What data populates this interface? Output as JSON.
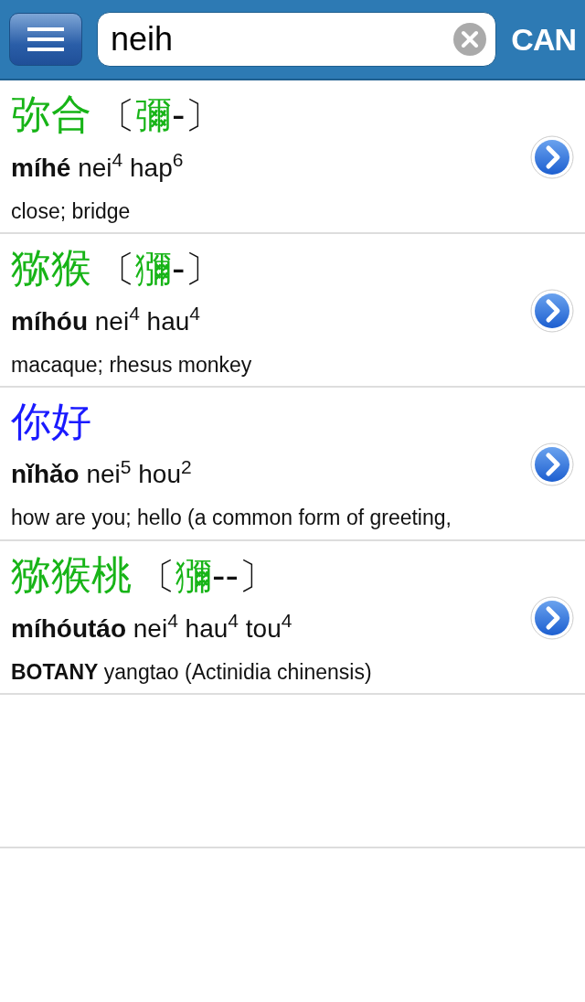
{
  "header": {
    "search": {
      "value": "neih"
    },
    "language": "CAN"
  },
  "entries": [
    {
      "headword": "弥合",
      "color": "#17b417",
      "variant": {
        "open": "〔",
        "chars": "彌",
        "fill": "-",
        "close": "〕"
      },
      "pinyin": "míhé",
      "jyutping": "nei$^{4}$ hap$^{6}$",
      "definition": "close; bridge"
    },
    {
      "headword": "猕猴",
      "color": "#17b417",
      "variant": {
        "open": "〔",
        "chars": "獼",
        "fill": "-",
        "close": "〕"
      },
      "pinyin": "míhóu",
      "jyutping": "nei$^{4}$ hau$^{4}$",
      "definition": "macaque; rhesus monkey"
    },
    {
      "headword": "你好",
      "color": "#1a1aff",
      "pinyin": "nǐhǎo",
      "jyutping": "nei$^{5}$ hou$^{2}$",
      "definition": "how are you; hello (a common form of greeting,"
    },
    {
      "headword": "猕猴桃",
      "color": "#17b417",
      "variant": {
        "open": "〔",
        "chars": "獼",
        "fill": "--",
        "close": "〕"
      },
      "pinyin": "míhóutáo",
      "jyutping": "nei$^{4}$ hau$^{4}$ tou$^{4}$",
      "definition": "**BOTANY** yangtao (Actinidia chinensis)"
    }
  ]
}
